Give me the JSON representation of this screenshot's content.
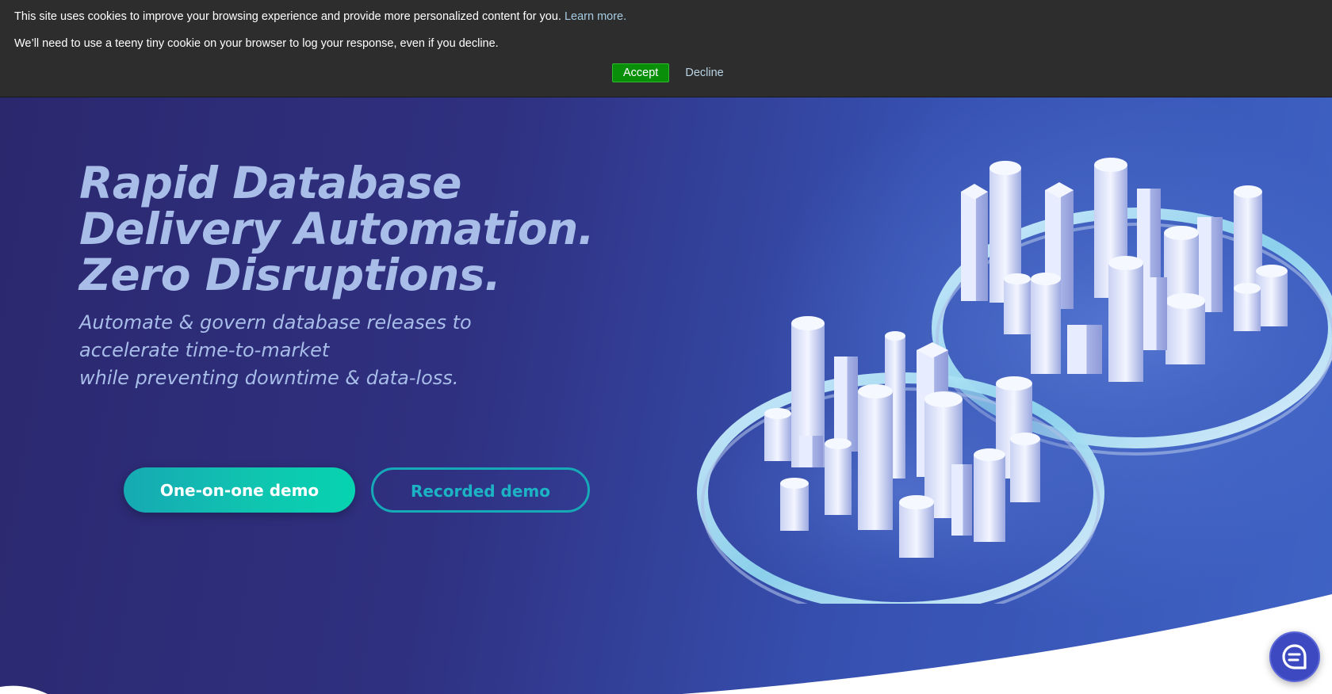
{
  "cookie_banner": {
    "message": "This site uses cookies to improve your browsing experience and provide more personalized content for you.",
    "learn_more": "Learn more.",
    "notice": "We’ll need to use a teeny tiny cookie on your browser to log your response, even if you decline.",
    "accept_label": "Accept",
    "decline_label": "Decline"
  },
  "hero": {
    "title_lines": [
      "Rapid Database",
      "Delivery Automation.",
      "Zero Disruptions."
    ],
    "subtitle_lines": [
      "Automate & govern database releases to",
      "accelerate time-to-market",
      "while preventing downtime & data-loss."
    ],
    "primary_cta": "One-on-one demo",
    "secondary_cta": "Recorded demo",
    "illustration_icon": "database-city-illustration"
  },
  "chat": {
    "icon": "chat-bubble-icon"
  },
  "colors": {
    "cookie_background": "#2d2d2d",
    "accept_green": "#0a8f0a",
    "link_blue": "#a6cde2",
    "hero_dark": "#2b286e",
    "hero_light": "#3f63c5",
    "title_text": "#a8bde8",
    "cta_teal": "#0fc6b0",
    "chat_blue": "#3d49c0"
  }
}
